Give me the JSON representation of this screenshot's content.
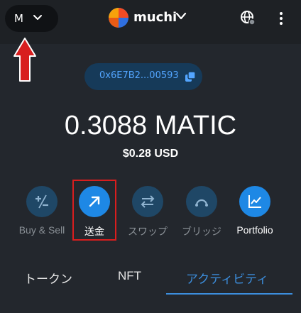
{
  "network": {
    "letter": "M",
    "chevron_icon": "chevron-down-icon"
  },
  "account": {
    "name": "muchi",
    "logo_icon": "account-logo-icon",
    "chevron_icon": "chevron-down-icon"
  },
  "toolbar": {
    "globe_icon": "globe-icon",
    "menu_icon": "kebab-menu-icon"
  },
  "address": {
    "text": "0x6E7B2...00593",
    "copy_icon": "copy-icon"
  },
  "balance": {
    "amount": "0.3088 MATIC",
    "fiat": "$0.28 USD"
  },
  "actions": [
    {
      "label": "Buy & Sell",
      "icon": "plus-minus-icon",
      "state": "dim"
    },
    {
      "label": "送金",
      "icon": "send-arrow-icon",
      "state": "bright"
    },
    {
      "label": "スワップ",
      "icon": "swap-arrows-icon",
      "state": "dim"
    },
    {
      "label": "ブリッジ",
      "icon": "bridge-icon",
      "state": "dim"
    },
    {
      "label": "Portfolio",
      "icon": "chart-icon",
      "state": "bright"
    }
  ],
  "tabs": [
    {
      "label": "トークン",
      "active": false
    },
    {
      "label": "NFT",
      "active": false
    },
    {
      "label": "アクティビティ",
      "active": true
    }
  ],
  "colors": {
    "background": "#23272d",
    "topbar": "#1e2125",
    "accent": "#1e88e5",
    "accent_text": "#3c8edd",
    "annotation_red": "#d81e1e"
  }
}
